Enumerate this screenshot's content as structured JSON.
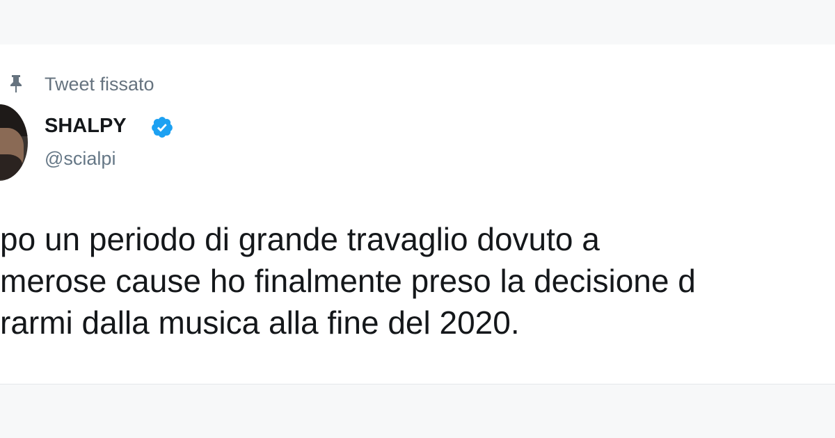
{
  "pinned": {
    "icon": "pin-icon",
    "label": "Tweet fissato"
  },
  "author": {
    "display_name": "SHALPY",
    "handle": "@scialpi",
    "verified_icon": "verified-badge-icon",
    "verified_color": "#1da1f2"
  },
  "tweet": {
    "lines": [
      "po un periodo di grande travaglio dovuto a",
      "merose cause ho finalmente preso la decisione d",
      "rarmi dalla musica alla fine del 2020."
    ]
  },
  "colors": {
    "background": "#f7f8f9",
    "card": "#ffffff",
    "text": "#14171a",
    "secondary_text": "#657786"
  }
}
